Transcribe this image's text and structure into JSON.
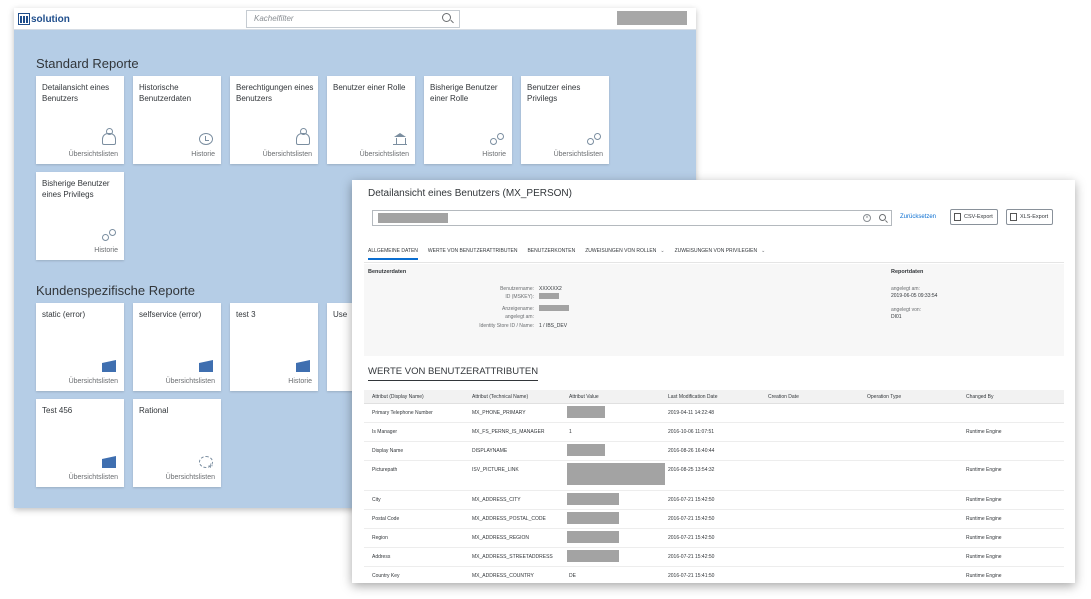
{
  "launchpad": {
    "logo_text": "solution",
    "tile_filter_placeholder": "Kachelfilter",
    "section_standard": "Standard Reporte",
    "section_custom": "Kundenspezifische Reporte",
    "standard_tiles": [
      {
        "title": "Detailansicht eines Benutzers",
        "footer": "Übersichtslisten",
        "icon": "person-icon"
      },
      {
        "title": "Historische Benutzerdaten",
        "footer": "Historie",
        "icon": "history-icon"
      },
      {
        "title": "Berechtigungen eines Benutzers",
        "footer": "Übersichtslisten",
        "icon": "person-check-icon"
      },
      {
        "title": "Benutzer einer Rolle",
        "footer": "Übersichtslisten",
        "icon": "role-icon"
      },
      {
        "title": "Bisherige Benutzer einer Rolle",
        "footer": "Historie",
        "icon": "group-icon"
      },
      {
        "title": "Benutzer eines Privilegs",
        "footer": "Übersichtslisten",
        "icon": "group-icon"
      },
      {
        "title": "Bisherige Benutzer eines Privilegs",
        "footer": "Historie",
        "icon": "group-icon"
      }
    ],
    "custom_tiles": [
      {
        "title": "static (error)",
        "footer": "Übersichtslisten",
        "icon": "folder-icon"
      },
      {
        "title": "selfservice (error)",
        "footer": "Übersichtslisten",
        "icon": "folder-icon"
      },
      {
        "title": "test 3",
        "footer": "Historie",
        "icon": "folder-icon"
      },
      {
        "title": "Use",
        "footer": "",
        "icon": ""
      },
      {
        "title": "Test 456",
        "footer": "Übersichtslisten",
        "icon": "folder-icon"
      },
      {
        "title": "Rational",
        "footer": "Übersichtslisten",
        "icon": "add-icon"
      }
    ]
  },
  "detail": {
    "title": "Detailansicht eines Benutzers (MX_PERSON)",
    "reset_link": "Zurücksetzen",
    "csv_export": "CSV-Export",
    "xls_export": "XLS-Export",
    "tabs": [
      {
        "label": "ALLGEMEINE DATEN",
        "active": true,
        "dropdown": false
      },
      {
        "label": "WERTE VON BENUTZERATTRIBUTEN",
        "active": false,
        "dropdown": false
      },
      {
        "label": "BENUTZERKONTEN",
        "active": false,
        "dropdown": false
      },
      {
        "label": "ZUWEISUNGEN VON ROLLEN",
        "active": false,
        "dropdown": true
      },
      {
        "label": "ZUWEISUNGEN VON PRIVILEGIEN",
        "active": false,
        "dropdown": true
      }
    ],
    "user_group_title": "Benutzerdaten",
    "user_fields": {
      "username_label": "Benutzername:",
      "username_value": "XXXXXX2",
      "id_label": "ID (MSKEY):",
      "display_label": "Anzeigename:",
      "logged_label": "angelegt am:",
      "idstore_label": "Identity Store ID / Name:",
      "idstore_value": "1 / IBS_DEV"
    },
    "report_group_title": "Reportdaten",
    "report_fields": {
      "created_label": "angelegt am:",
      "created_value": "2019-06-05 09:33:54",
      "by_label": "angelegt von:",
      "by_value": "DI01"
    },
    "attr_section_title": "WERTE VON BENUTZERATTRIBUTEN",
    "table_headers": [
      "Attribut (Display Name)",
      "Attribut (Technical Name)",
      "Attribut Value",
      "Last Modification Date",
      "Creation Date",
      "Operation Type",
      "Changed By"
    ],
    "rows": [
      {
        "display": "Primary Telephone Number",
        "technical": "MX_PHONE_PRIMARY",
        "value": "",
        "modified": "2019-04-11 14:22:48",
        "created": "",
        "op": "",
        "changed_by": ""
      },
      {
        "display": "Is Manager",
        "technical": "MX_FS_PERNR_IS_MANAGER",
        "value": "1",
        "modified": "2016-10-06 11:07:51",
        "created": "",
        "op": "",
        "changed_by": "Runtime Engine"
      },
      {
        "display": "Display Name",
        "technical": "DISPLAYNAME",
        "value": "",
        "modified": "2016-08-26 16:40:44",
        "created": "",
        "op": "",
        "changed_by": ""
      },
      {
        "display": "Picturepath",
        "technical": "ISV_PICTURE_LINK",
        "value": "",
        "modified": "2016-08-25 13:54:32",
        "created": "",
        "op": "",
        "changed_by": "Runtime Engine"
      },
      {
        "display": "City",
        "technical": "MX_ADDRESS_CITY",
        "value": "",
        "modified": "2016-07-21 15:42:50",
        "created": "",
        "op": "",
        "changed_by": "Runtime Engine"
      },
      {
        "display": "Postal Code",
        "technical": "MX_ADDRESS_POSTAL_CODE",
        "value": "",
        "modified": "2016-07-21 15:42:50",
        "created": "",
        "op": "",
        "changed_by": "Runtime Engine"
      },
      {
        "display": "Region",
        "technical": "MX_ADDRESS_REGION",
        "value": "",
        "modified": "2016-07-21 15:42:50",
        "created": "",
        "op": "",
        "changed_by": "Runtime Engine"
      },
      {
        "display": "Address",
        "technical": "MX_ADDRESS_STREETADDRESS",
        "value": "",
        "modified": "2016-07-21 15:42:50",
        "created": "",
        "op": "",
        "changed_by": "Runtime Engine"
      },
      {
        "display": "Country Key",
        "technical": "MX_ADDRESS_COUNTRY",
        "value": "DE",
        "modified": "2016-07-21 15:41:50",
        "created": "",
        "op": "",
        "changed_by": "Runtime Engine"
      }
    ]
  }
}
